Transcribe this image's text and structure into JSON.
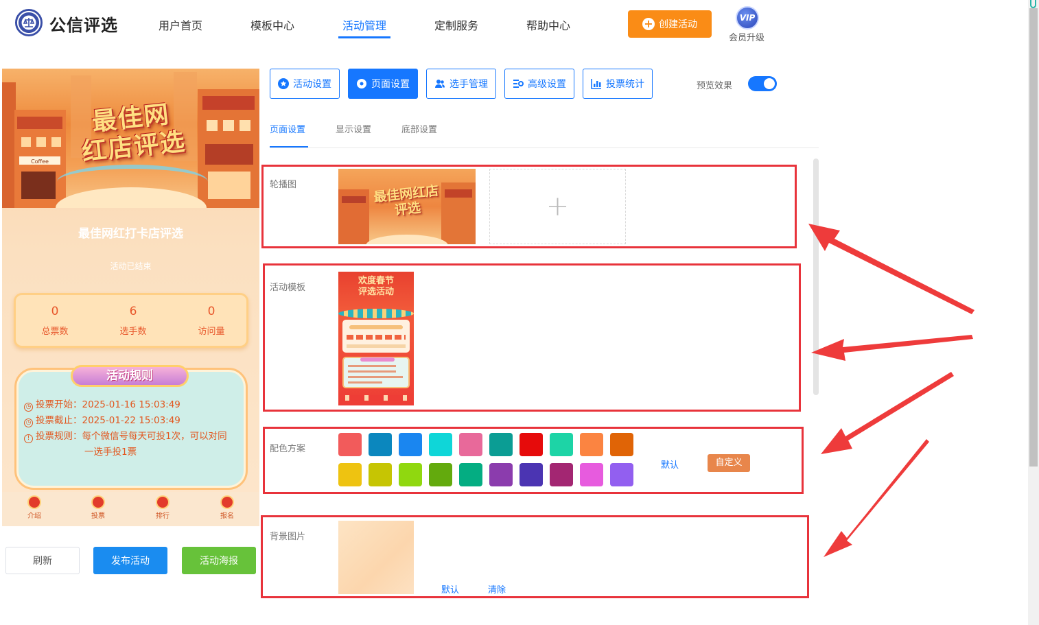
{
  "header": {
    "logo_text": "公信评选",
    "nav": [
      "用户首页",
      "模板中心",
      "活动管理",
      "定制服务",
      "帮助中心"
    ],
    "active_nav": "活动管理",
    "create_button": "创建活动",
    "vip_badge": "VIP",
    "vip_label": "会员升级"
  },
  "preview": {
    "banner_title_line1": "最佳网",
    "banner_title_line2": "红店评选",
    "banner_shop_sign": "Coffee",
    "title": "最佳网红打卡店评选",
    "status": "活动已结束",
    "stats": [
      {
        "value": "0",
        "label": "总票数"
      },
      {
        "value": "6",
        "label": "选手数"
      },
      {
        "value": "0",
        "label": "访问量"
      }
    ],
    "rules_title": "活动规则",
    "rules": [
      {
        "label": "投票开始：",
        "value": "2025-01-16 15:03:49"
      },
      {
        "label": "投票截止：",
        "value": "2025-01-22 15:03:49"
      },
      {
        "label": "投票规则：",
        "value": "每个微信号每天可投1次，可以对同"
      }
    ],
    "rules_continued": "一选手投1票",
    "tabbar": [
      "介绍",
      "投票",
      "排行",
      "报名"
    ],
    "buttons": {
      "refresh": "刷新",
      "publish": "发布活动",
      "poster": "活动海报"
    }
  },
  "settings": {
    "tabs": [
      {
        "label": "活动设置",
        "icon": "star-icon"
      },
      {
        "label": "页面设置",
        "icon": "gear-icon"
      },
      {
        "label": "选手管理",
        "icon": "users-icon"
      },
      {
        "label": "高级设置",
        "icon": "sliders-icon"
      },
      {
        "label": "投票统计",
        "icon": "bar-chart-icon"
      }
    ],
    "active_tab": "页面设置",
    "preview_toggle_label": "预览效果",
    "preview_toggle_on": true,
    "sub_tabs": [
      "页面设置",
      "显示设置",
      "底部设置"
    ],
    "active_sub_tab": "页面设置",
    "carousel_label": "轮播图",
    "carousel_image_title": "最佳网红店评选",
    "template_label": "活动模板",
    "template_title_line1": "欢度春节",
    "template_title_line2": "评选活动",
    "color_label": "配色方案",
    "colors_row1": [
      "#f25b5b",
      "#0b87be",
      "#1a86f0",
      "#0fd6d8",
      "#e8699a",
      "#0b9d94",
      "#e60b0b",
      "#1dd4a6",
      "#fb8441",
      "#e06406"
    ],
    "colors_row2": [
      "#eec311",
      "#c6c503",
      "#90d80f",
      "#63aa0d",
      "#04ad82",
      "#8b3cad",
      "#4b34b2",
      "#a32672",
      "#e75bde",
      "#925ff0"
    ],
    "color_default": "默认",
    "color_custom": "自定义",
    "bg_label": "背景图片",
    "bg_default": "默认",
    "bg_clear": "清除"
  },
  "colors": {
    "accent": "#1677ff",
    "orange": "#fa8c16",
    "highlight": "#e8333b",
    "green": "#67c23a"
  }
}
